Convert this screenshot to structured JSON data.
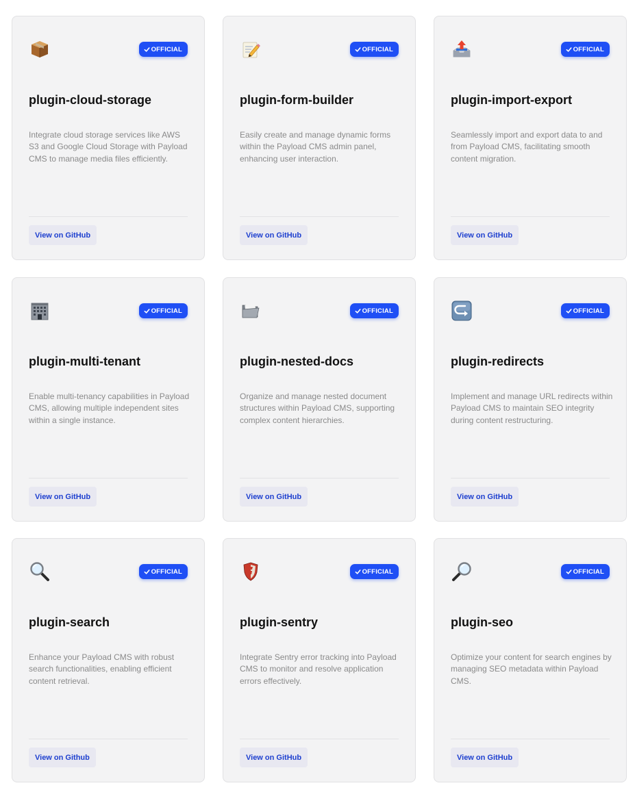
{
  "badge_label": "OFFICIAL",
  "link_label": "View on GitHub",
  "colors": {
    "badge_bg": "#1f4ff5",
    "card_bg": "#f3f3f4",
    "link_text": "#1d3fcf",
    "link_bg": "#e8e8f1"
  },
  "plugins": [
    {
      "icon": "package-icon",
      "title": "plugin-cloud-storage",
      "description": "Integrate cloud storage services like AWS S3 and Google Cloud Storage with Payload CMS to manage media files efficiently.",
      "link": "View on GitHub"
    },
    {
      "icon": "memo-pencil-icon",
      "title": "plugin-form-builder",
      "description": "Easily create and manage dynamic forms within the Payload CMS admin panel, enhancing user interaction.",
      "link": "View on GitHub"
    },
    {
      "icon": "outbox-tray-icon",
      "title": "plugin-import-export",
      "description": "Seamlessly import and export data to and from Payload CMS, facilitating smooth content migration.",
      "link": "View on GitHub"
    },
    {
      "icon": "office-building-icon",
      "title": "plugin-multi-tenant",
      "description": "Enable multi-tenancy capabilities in Payload CMS, allowing multiple independent sites within a single instance.",
      "link": "View on GitHub"
    },
    {
      "icon": "open-folder-icon",
      "title": "plugin-nested-docs",
      "description": "Organize and manage nested document structures within Payload CMS, supporting complex content hierarchies.",
      "link": "View on GitHub"
    },
    {
      "icon": "redirect-arrow-icon",
      "title": "plugin-redirects",
      "description": "Implement and manage URL redirects within Payload CMS to maintain SEO integrity during content restructuring.",
      "link": "View on GitHub"
    },
    {
      "icon": "magnifying-glass-left-icon",
      "title": "plugin-search",
      "description": "Enhance your Payload CMS with robust search functionalities, enabling efficient content retrieval.",
      "link": "View on Github"
    },
    {
      "icon": "sentry-shield-icon",
      "title": "plugin-sentry",
      "description": "Integrate Sentry error tracking into Payload CMS to monitor and resolve application errors effectively.",
      "link": "View on GitHub"
    },
    {
      "icon": "magnifying-glass-right-icon",
      "title": "plugin-seo",
      "description": "Optimize your content for search engines by managing SEO metadata within Payload CMS.",
      "link": "View on GitHub"
    }
  ]
}
